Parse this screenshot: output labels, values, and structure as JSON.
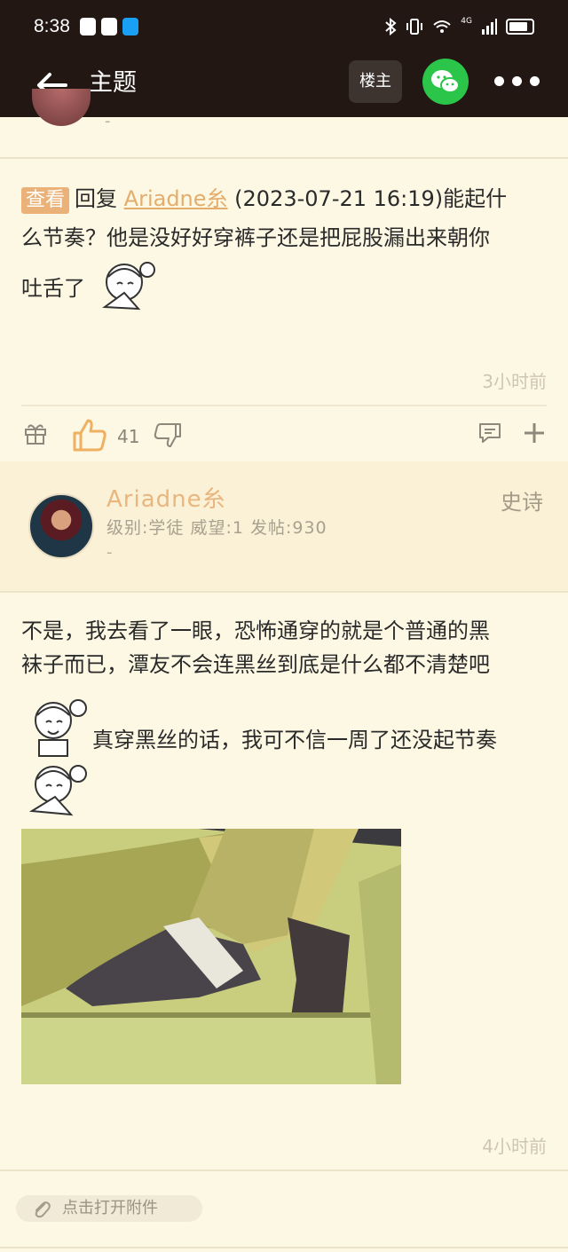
{
  "status_bar": {
    "time": "8:38",
    "network_badge": "4G"
  },
  "toolbar": {
    "title": "主题",
    "owner_button": "楼主",
    "icons": [
      "back-arrow-icon",
      "wechat-icon",
      "more-icon"
    ]
  },
  "post1": {
    "author_extra": "-",
    "reply_tag": "查看",
    "reply_prefix": "回复",
    "reply_user": "Ariadne糸",
    "reply_time": "(2023-07-21 16:19)",
    "text_line1_tail": "能起什",
    "text_line2": "么节奏？他是没好好穿裤子还是把屁股漏出来朝你",
    "text_line3": "吐舌了",
    "time_ago": "3小时前",
    "like_count": "41"
  },
  "post2": {
    "author": "Ariadne糸",
    "meta": "级别:学徒 威望:1 发帖:930",
    "author_extra": "-",
    "rank": "史诗",
    "text_line1": "不是，我去看了一眼，恐怖通穿的就是个普通的黑",
    "text_line2": "袜子而已，潭友不会连黑丝到底是什么都不清楚吧",
    "text_line3": "真穿黑丝的话，我可不信一周了还没起节奏",
    "time_ago": "4小时前"
  },
  "attachment": {
    "label": "点击打开附件"
  },
  "colors": {
    "bar_bg": "#231713",
    "page_bg": "#fdf8e3",
    "accent": "#e8b67e",
    "like_active": "#f0b062"
  }
}
